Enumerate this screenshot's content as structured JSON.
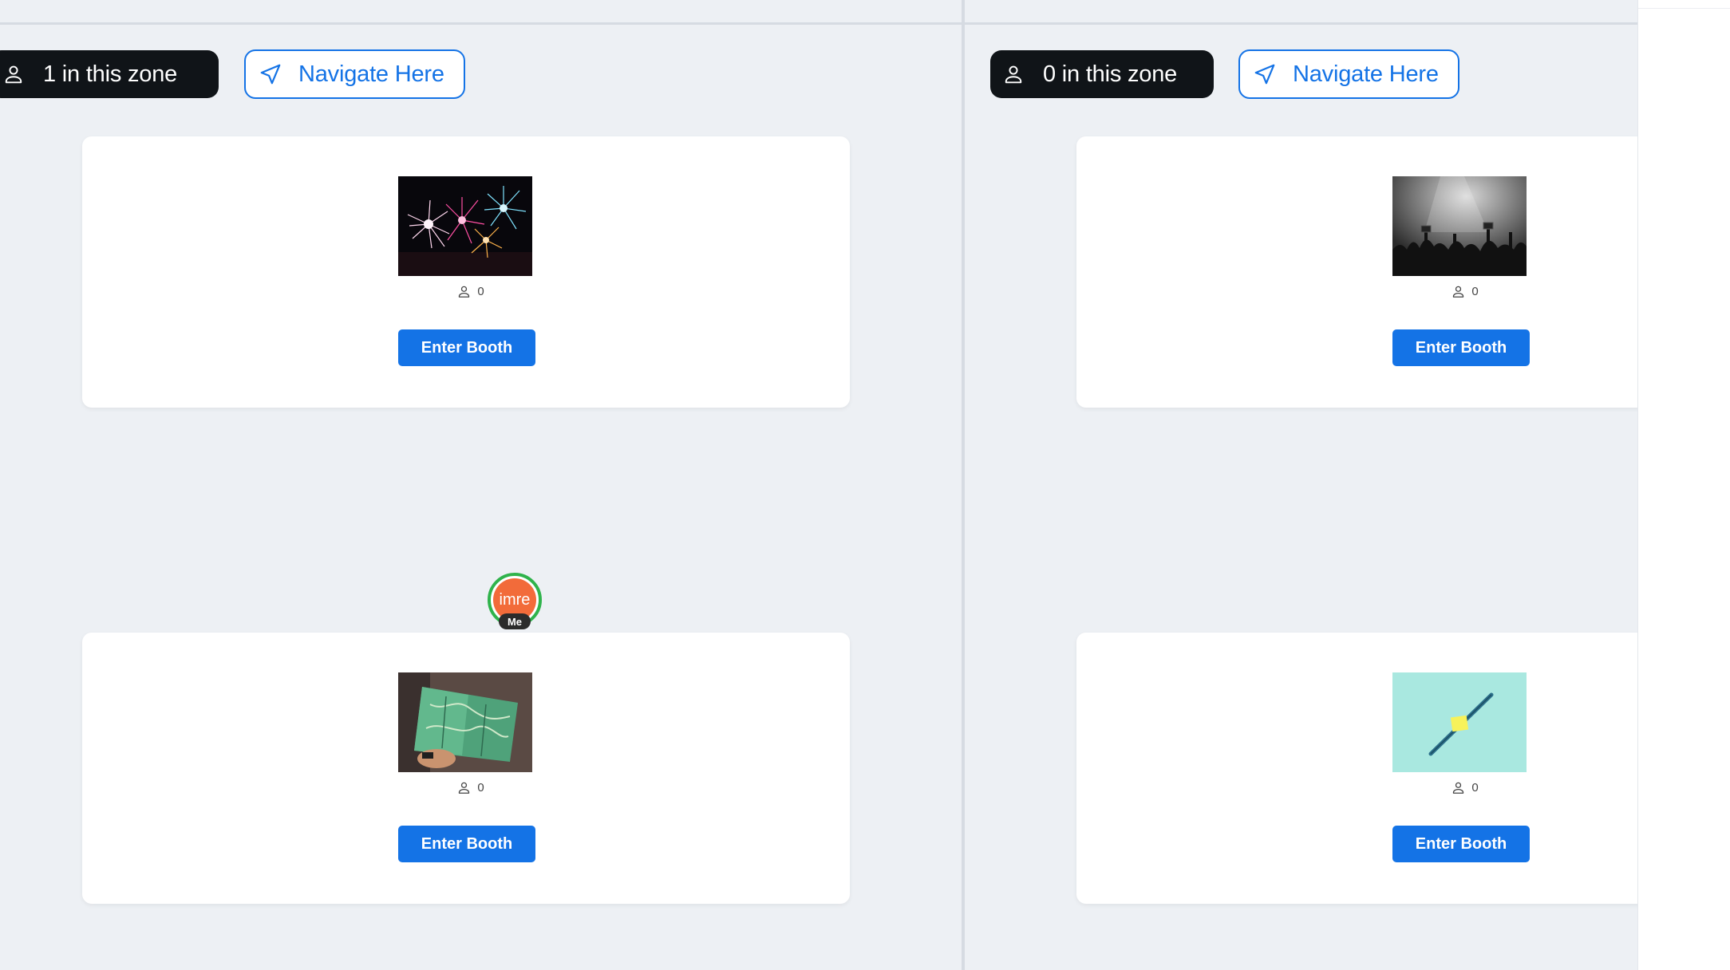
{
  "zones": [
    {
      "count_label": "1 in this zone",
      "navigate_label": "Navigate Here",
      "booths": [
        {
          "image": "fireworks",
          "attendees": "0",
          "enter_label": "Enter Booth"
        },
        {
          "image": "map-in-hands",
          "attendees": "0",
          "enter_label": "Enter Booth"
        }
      ]
    },
    {
      "count_label": "0 in this zone",
      "navigate_label": "Navigate Here",
      "booths": [
        {
          "image": "concert-crowd",
          "attendees": "0",
          "enter_label": "Enter Booth"
        },
        {
          "image": "pen-sticky-note",
          "attendees": "0",
          "enter_label": "Enter Booth"
        }
      ]
    }
  ],
  "user_avatar": {
    "name": "imre",
    "badge": "Me"
  },
  "colors": {
    "accent": "#1473e6",
    "pill_bg": "#101418",
    "canvas_bg": "#edf0f4",
    "avatar_bg": "#f26b3a",
    "avatar_ring": "#2fb34b"
  },
  "icons": {
    "person": "person-icon",
    "navigate": "navigation-arrow-icon"
  }
}
